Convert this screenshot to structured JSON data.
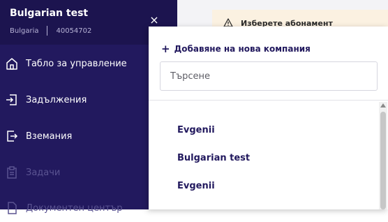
{
  "sidebar": {
    "company": {
      "name": "Bulgarian test",
      "country": "Bulgaria",
      "id": "40054702"
    },
    "close_symbol": "×",
    "nav_items": [
      {
        "label": "Табло за управление",
        "icon": "home-icon",
        "disabled": false
      },
      {
        "label": "Задължения",
        "icon": "sign-in-icon",
        "disabled": false
      },
      {
        "label": "Вземания",
        "icon": "sign-out-icon",
        "disabled": false
      },
      {
        "label": "Задачи",
        "icon": "clipboard-icon",
        "disabled": true
      },
      {
        "label": "Документен център",
        "icon": "document-icon",
        "disabled": true
      }
    ],
    "colors": {
      "background": "#22195e",
      "header": "#1c144f",
      "disabled_text": "#5a5391"
    }
  },
  "banner": {
    "text": "Изберете абонамент",
    "icon": "warning-icon",
    "background": "#fbf1e1"
  },
  "dropdown": {
    "add_company_label": "Добавяне на нова компания",
    "search": {
      "placeholder": "Търсене",
      "value": ""
    },
    "companies": [
      "Evgenii",
      "Bulgarian test",
      "Evgenii"
    ]
  }
}
